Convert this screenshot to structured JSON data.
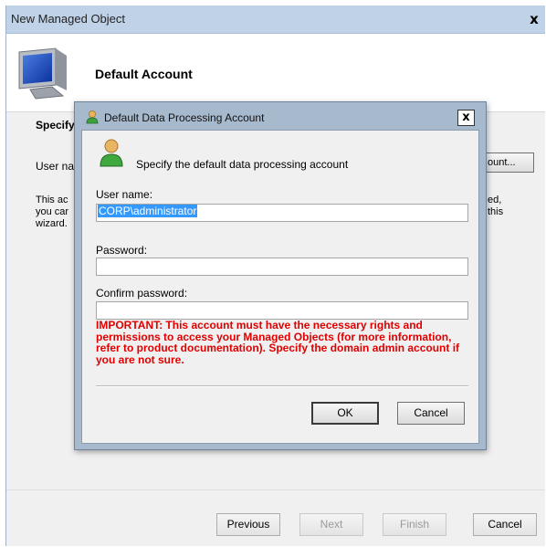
{
  "wizard": {
    "title": "New Managed Object",
    "close_glyph": "x",
    "heading": "Default Account",
    "specify_label": "Specify",
    "username_label": "User na",
    "account_button_label": "ount...",
    "body_text": {
      "left_lines": [
        "This ac",
        "you car",
        "wizard."
      ],
      "right_lines": [
        "ed,",
        "this"
      ]
    },
    "footer": {
      "previous_label": "Previous",
      "next_label": "Next",
      "finish_label": "Finish",
      "cancel_label": "Cancel"
    }
  },
  "dialog": {
    "title": "Default Data Processing Account",
    "close_glyph": "x",
    "prompt": "Specify the default data processing account",
    "username_label": "User name:",
    "username_value": "CORP\\administrator",
    "password_label": "Password:",
    "password_value": "",
    "confirm_label": "Confirm password:",
    "confirm_value": "",
    "warning": "IMPORTANT: This account must have the necessary rights and permissions to access your Managed Objects (for more information, refer to product documentation). Specify the domain admin account if you are not sure.",
    "ok_label": "OK",
    "cancel_label": "Cancel"
  },
  "colors": {
    "titlebar": "#bfd2e8",
    "dialog_frame": "#a7b9cd",
    "warning_text": "#e00000",
    "selection": "#3399ff"
  },
  "icons": {
    "wizard_header": "monitor-icon",
    "dialog_title": "user-icon",
    "dialog_prompt": "user-icon"
  }
}
